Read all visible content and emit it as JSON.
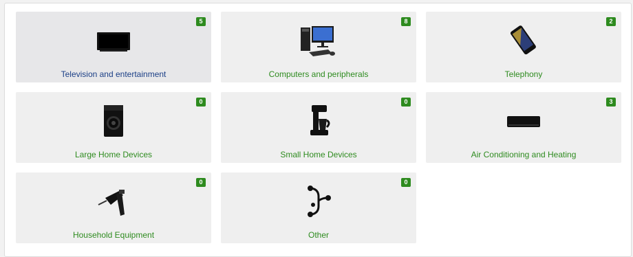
{
  "categories": [
    {
      "label": "Television and entertainment",
      "count": "5",
      "icon": "television-icon",
      "active": true
    },
    {
      "label": "Computers and peripherals",
      "count": "8",
      "icon": "desktop-computer-icon"
    },
    {
      "label": "Telephony",
      "count": "2",
      "icon": "smartphone-icon"
    },
    {
      "label": "Large Home Devices",
      "count": "0",
      "icon": "washing-machine-icon"
    },
    {
      "label": "Small Home Devices",
      "count": "0",
      "icon": "coffee-maker-icon"
    },
    {
      "label": "Air Conditioning and Heating",
      "count": "3",
      "icon": "air-conditioner-icon"
    },
    {
      "label": "Household Equipment",
      "count": "0",
      "icon": "drill-icon"
    },
    {
      "label": "Other",
      "count": "0",
      "icon": "branch-nodes-icon"
    }
  ],
  "colors": {
    "accent_green": "#2e8b1f",
    "active_label_blue": "#1b3f86",
    "card_bg": "#efefef"
  }
}
